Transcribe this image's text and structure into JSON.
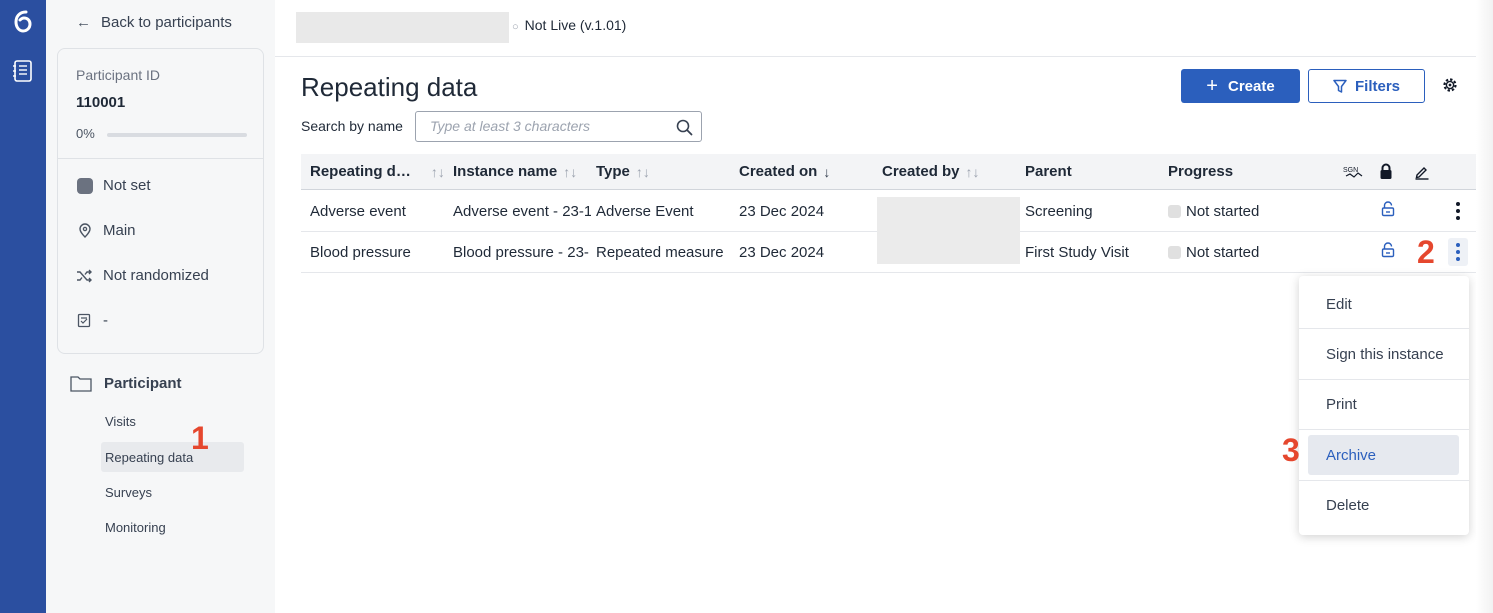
{
  "rail": {
    "logo_icon": "app-logo-icon",
    "nav_icon": "notebook-icon",
    "color": "#2b4fa0"
  },
  "sidebar": {
    "back_label": "Back to participants",
    "participant_id_label": "Participant ID",
    "participant_id": "110001",
    "progress_text": "0%",
    "progress_value": 0,
    "status": "Not set",
    "site": "Main",
    "randomization": "Not randomized",
    "form_status": "-",
    "folder_label": "Participant",
    "nav_items": [
      "Visits",
      "Repeating data",
      "Surveys",
      "Monitoring"
    ],
    "active_nav": "Repeating data"
  },
  "topbar": {
    "version": "Not Live (v.1.01)"
  },
  "page": {
    "title": "Repeating data",
    "create_label": "Create",
    "filters_label": "Filters",
    "search_label": "Search by name",
    "search_placeholder": "Type at least 3 characters"
  },
  "table": {
    "headers": [
      "Repeating d…",
      "Instance name",
      "Type",
      "Created on",
      "Created by",
      "Parent",
      "Progress"
    ],
    "rows": [
      {
        "repeating": "Adverse event",
        "instance": "Adverse event - 23-1",
        "type": "Adverse Event",
        "created_on": "23 Dec 2024",
        "parent": "Screening",
        "progress": "Not started"
      },
      {
        "repeating": "Blood pressure",
        "instance": "Blood pressure - 23-",
        "type": "Repeated measure",
        "created_on": "23 Dec 2024",
        "parent": "First Study Visit",
        "progress": "Not started"
      }
    ]
  },
  "menu": {
    "items": [
      "Edit",
      "Sign this instance",
      "Print",
      "Archive",
      "Delete"
    ],
    "highlighted": "Archive"
  },
  "annotations": {
    "step1": "1",
    "step2": "2",
    "step3": "3",
    "color": "#e5472e"
  },
  "colors": {
    "primary": "#2b5fbd"
  }
}
